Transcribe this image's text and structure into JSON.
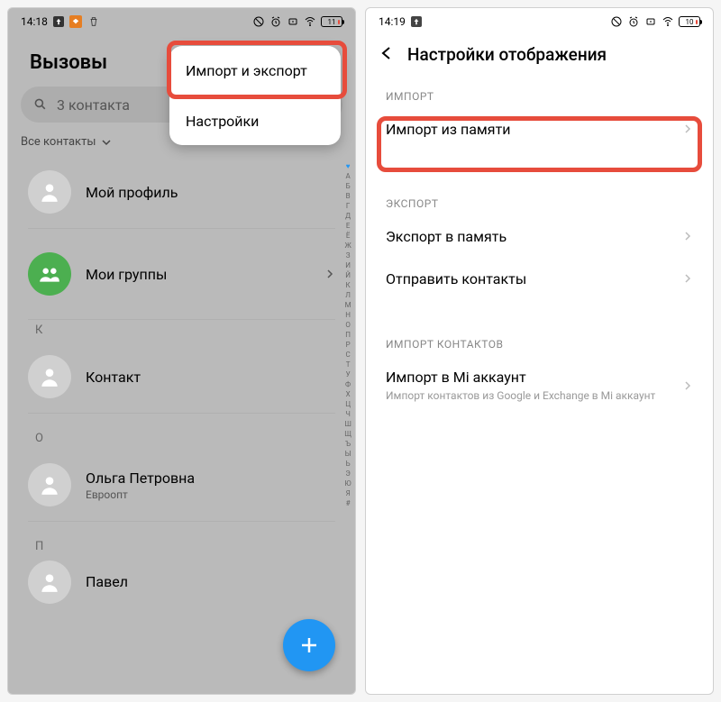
{
  "left": {
    "statusbar": {
      "time": "14:18",
      "battery": "11"
    },
    "title": "Вызовы",
    "search": {
      "placeholder": "3 контакта"
    },
    "filter": "Все контакты",
    "popup": {
      "item1": "Импорт и экспорт",
      "item2": "Настройки"
    },
    "rows": {
      "profile": "Мой профиль",
      "groups": "Мои группы",
      "k_letter": "К",
      "contact": "Контакт",
      "o_letter": "О",
      "olga": "Ольга Петровна",
      "olga_sub": "Евроопт",
      "p_letter": "П",
      "pavel": "Павел"
    },
    "index": "АБВГДЕЁЖЗИЙКЛМНОПРСТУФХЦЧШЩЪЫЬЭЮЯ#"
  },
  "right": {
    "statusbar": {
      "time": "14:19",
      "battery": "10"
    },
    "title": "Настройки отображения",
    "sections": {
      "import": "ИМПОРТ",
      "import_mem": "Импорт из памяти",
      "export": "ЭКСПОРТ",
      "export_mem": "Экспорт в память",
      "send": "Отправить контакты",
      "import_contacts": "ИМПОРТ КОНТАКТОВ",
      "mi_title": "Импорт в Mi аккаунт",
      "mi_sub": "Импорт контактов из Google и Exchange в Mi аккаунт"
    }
  }
}
